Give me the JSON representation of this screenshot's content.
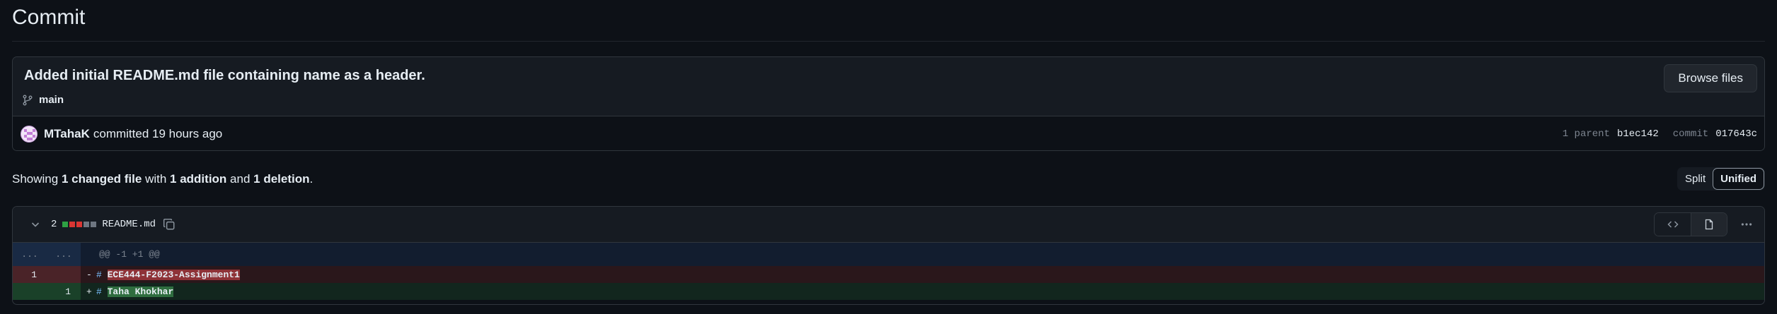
{
  "page": {
    "title": "Commit"
  },
  "commit": {
    "message": "Added initial README.md file containing name as a header.",
    "branch": "main",
    "browse_label": "Browse files",
    "author": "MTahaK",
    "time_text": "committed 19 hours ago",
    "parent_label": "1 parent",
    "parent_sha": "b1ec142",
    "commit_label": "commit",
    "commit_sha": "017643c"
  },
  "summary": {
    "prefix": "Showing",
    "changed_files": "1 changed file",
    "with": "with",
    "additions": "1 addition",
    "and": "and",
    "deletions": "1 deletion",
    "suffix": "."
  },
  "view_toggle": {
    "split_label": "Split",
    "unified_label": "Unified",
    "selected": "Unified"
  },
  "file": {
    "change_count": "2",
    "name": "README.md",
    "diffstat": [
      "#2ea043",
      "#da3633",
      "#da3633",
      "#6e7681",
      "#6e7681"
    ],
    "hunk": {
      "old_ln": "...",
      "new_ln": "...",
      "header": "@@ -1 +1 @@"
    },
    "lines": [
      {
        "type": "del",
        "old_ln": "1",
        "new_ln": "",
        "sign": "-",
        "hash": "#",
        "text": "ECE444-F2023-Assignment1"
      },
      {
        "type": "add",
        "old_ln": "",
        "new_ln": "1",
        "sign": "+",
        "hash": "#",
        "text": "Taha Khokhar"
      }
    ]
  },
  "icons": {
    "branch": "git-branch-icon",
    "avatar": "user-avatar",
    "chevron": "chevron-down-icon",
    "copy": "copy-icon",
    "code": "code-icon",
    "file": "file-icon",
    "kebab": "kebab-horizontal-icon"
  },
  "colors": {
    "background": "#0d1117",
    "panel": "#161b22",
    "border": "#30363d",
    "deletion_bg": "#2a171b",
    "deletion_highlight": "#8e3237",
    "addition_bg": "#12261e",
    "addition_highlight": "#2f6d3f",
    "hunk_bg": "#121d2f"
  }
}
